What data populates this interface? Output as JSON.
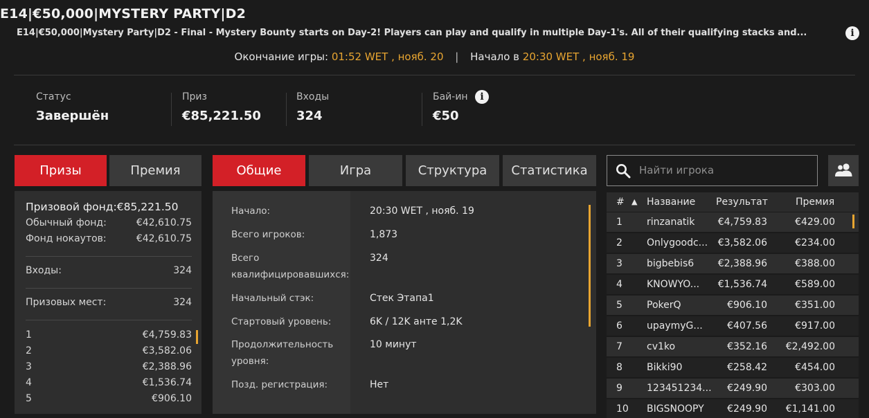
{
  "header": {
    "title": "E14|€50,000|MYSTERY PARTY|D2",
    "subtitle": "E14|€50,000|Mystery Party|D2 - Final - Mystery Bounty starts on Day-2! Players can play and qualify in multiple Day-1's. All of their qualifying stacks and...",
    "end_label": "Окончание игры:",
    "end_value": "01:52 WET , нояб. 20",
    "separator": "|",
    "start_label": "Начало в",
    "start_value": "20:30 WET , нояб. 19"
  },
  "stats": {
    "status_label": "Статус",
    "status_value": "Завершён",
    "prize_label": "Приз",
    "prize_value": "€85,221.50",
    "entries_label": "Входы",
    "entries_value": "324",
    "buyin_label": "Бай-ин",
    "buyin_value": "€50"
  },
  "left_tabs": [
    "Призы",
    "Премия"
  ],
  "prize_panel": {
    "pool_label": "Призовой фонд:",
    "pool_value": "€85,221.50",
    "regular_label": "Обычный фонд:",
    "regular_value": "€42,610.75",
    "ko_label": "Фонд нокаутов:",
    "ko_value": "€42,610.75",
    "entries_label": "Входы:",
    "entries_value": "324",
    "places_label": "Призовых мест:",
    "places_value": "324",
    "payouts": [
      {
        "place": "1",
        "amount": "€4,759.83"
      },
      {
        "place": "2",
        "amount": "€3,582.06"
      },
      {
        "place": "3",
        "amount": "€2,388.96"
      },
      {
        "place": "4",
        "amount": "€1,536.74"
      },
      {
        "place": "5",
        "amount": "€906.10"
      }
    ]
  },
  "center_tabs": [
    "Общие",
    "Игра",
    "Структура",
    "Статистика"
  ],
  "general_info": [
    {
      "label": "Начало:",
      "value": "20:30 WET , нояб. 19"
    },
    {
      "label": "Всего игроков:",
      "value": "1,873"
    },
    {
      "label": "Всего квалифицировавшихся:",
      "value": "324"
    },
    {
      "label": "Начальный стэк:",
      "value": "Стек Этапа1"
    },
    {
      "label": "Стартовый уровень:",
      "value": "6K / 12K анте 1,2K"
    },
    {
      "label": "Продолжительность уровня:",
      "value": "10 минут"
    },
    {
      "label": "Позд. регистрация:",
      "value": "Нет"
    }
  ],
  "search": {
    "placeholder": "Найти игрока"
  },
  "leaderboard": {
    "headers": {
      "num": "#",
      "sort": "▲",
      "name": "Название",
      "result": "Результат",
      "bonus": "Премия"
    },
    "rows": [
      {
        "num": "1",
        "name": "rinzanatik",
        "result": "€4,759.83",
        "bonus": "€429.00"
      },
      {
        "num": "2",
        "name": "Onlygoodc...",
        "result": "€3,582.06",
        "bonus": "€234.00"
      },
      {
        "num": "3",
        "name": "bigbebis6",
        "result": "€2,388.96",
        "bonus": "€388.00"
      },
      {
        "num": "4",
        "name": "KNOWYO...",
        "result": "€1,536.74",
        "bonus": "€589.00"
      },
      {
        "num": "5",
        "name": "PokerQ",
        "result": "€906.10",
        "bonus": "€351.00"
      },
      {
        "num": "6",
        "name": "upaymyG...",
        "result": "€407.56",
        "bonus": "€917.00"
      },
      {
        "num": "7",
        "name": "cv1ko",
        "result": "€352.16",
        "bonus": "€2,492.00"
      },
      {
        "num": "8",
        "name": "Bikki90",
        "result": "€258.42",
        "bonus": "€454.00"
      },
      {
        "num": "9",
        "name": "123451234...",
        "result": "€249.90",
        "bonus": "€303.00"
      },
      {
        "num": "10",
        "name": "BIGSNOOPY",
        "result": "€249.90",
        "bonus": "€1,141.00"
      }
    ]
  },
  "icons": {
    "info": "info-icon",
    "search": "search-icon",
    "users": "users-icon"
  },
  "colors": {
    "accent": "#d32027",
    "highlight": "#e8a531",
    "background": "#1b1b1b"
  }
}
